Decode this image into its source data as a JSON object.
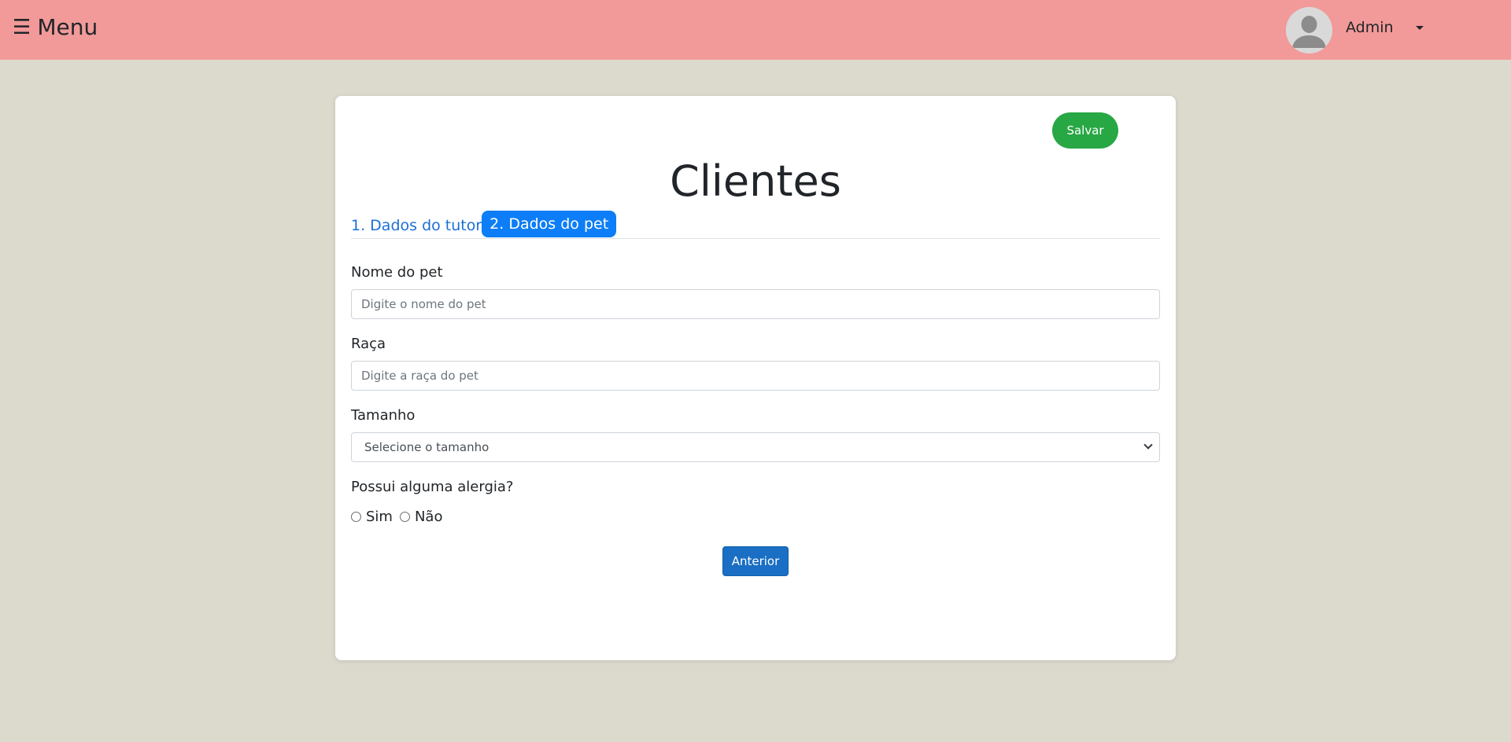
{
  "topbar": {
    "menu_icon": "hamburger-icon",
    "menu_label": "Menu",
    "avatar_icon": "user-avatar-icon",
    "user_name": "Admin",
    "caret_icon": "caret-down-icon",
    "background_color": "#f29a99"
  },
  "card": {
    "save_label": "Salvar",
    "title": "Clientes",
    "tabs": [
      {
        "label": "1. Dados do tutor",
        "active": false
      },
      {
        "label": "2. Dados do pet",
        "active": true
      }
    ],
    "fields": {
      "pet_name": {
        "label": "Nome do pet",
        "placeholder": "Digite o nome do pet",
        "value": ""
      },
      "breed": {
        "label": "Raça",
        "placeholder": "Digite a raça do pet",
        "value": ""
      },
      "size": {
        "label": "Tamanho",
        "selected": "Selecione o tamanho"
      },
      "allergy": {
        "label": "Possui alguma alergia?",
        "options": [
          "Sim",
          "Não"
        ],
        "selected": null
      }
    },
    "previous_label": "Anterior"
  },
  "colors": {
    "page_background": "#dcd9cd",
    "save_button": "#28a745",
    "active_tab": "#0d7ef7",
    "link": "#1a6fd8",
    "primary_button": "#1a6fc4"
  }
}
